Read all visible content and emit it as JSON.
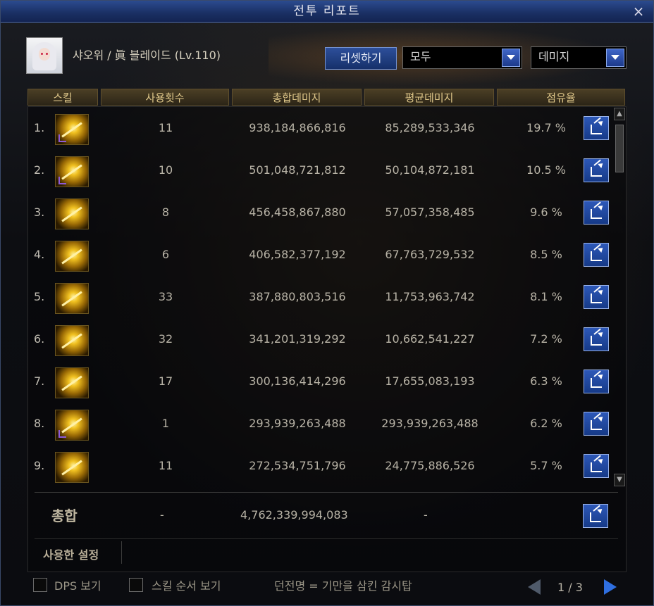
{
  "window": {
    "title": "전투 리포트",
    "close_label": "×"
  },
  "character": {
    "name": "샤오위 / 眞 블레이드 (Lv.110)"
  },
  "controls": {
    "reset_label": "리셋하기",
    "filter_select": "모두",
    "metric_select": "데미지"
  },
  "table": {
    "headers": [
      "스킬",
      "사용횟수",
      "총합데미지",
      "평균데미지",
      "점유율"
    ],
    "rows": [
      {
        "rank": "1.",
        "count": "11",
        "total": "938,184,866,816",
        "avg": "85,289,533,346",
        "share": "19.7 %"
      },
      {
        "rank": "2.",
        "count": "10",
        "total": "501,048,721,812",
        "avg": "50,104,872,181",
        "share": "10.5 %"
      },
      {
        "rank": "3.",
        "count": "8",
        "total": "456,458,867,880",
        "avg": "57,057,358,485",
        "share": "9.6 %"
      },
      {
        "rank": "4.",
        "count": "6",
        "total": "406,582,377,192",
        "avg": "67,763,729,532",
        "share": "8.5 %"
      },
      {
        "rank": "5.",
        "count": "33",
        "total": "387,880,803,516",
        "avg": "11,753,963,742",
        "share": "8.1 %"
      },
      {
        "rank": "6.",
        "count": "32",
        "total": "341,201,319,292",
        "avg": "10,662,541,227",
        "share": "7.2 %"
      },
      {
        "rank": "7.",
        "count": "17",
        "total": "300,136,414,296",
        "avg": "17,655,083,193",
        "share": "6.3 %"
      },
      {
        "rank": "8.",
        "count": "1",
        "total": "293,939,263,488",
        "avg": "293,939,263,488",
        "share": "6.2 %"
      },
      {
        "rank": "9.",
        "count": "11",
        "total": "272,534,751,796",
        "avg": "24,775,886,526",
        "share": "5.7 %"
      }
    ]
  },
  "totals": {
    "label": "총합",
    "count": "-",
    "total": "4,762,339,994,083",
    "avg": "-"
  },
  "used_settings": {
    "label": "사용한 설정"
  },
  "footer": {
    "dps_label": "DPS 보기",
    "skill_order_label": "스킬 순서 보기",
    "dungeon_label": "던전명 = 기만을 삼킨 감시탑",
    "page": "1 / 3"
  },
  "colors": {
    "accent_blue": "#2d58b8",
    "header_gold": "#e0c88a",
    "text": "#b8b3a6"
  },
  "icons": {
    "share": "share-icon",
    "close": "close-icon",
    "dropdown": "chevron-down-icon"
  }
}
